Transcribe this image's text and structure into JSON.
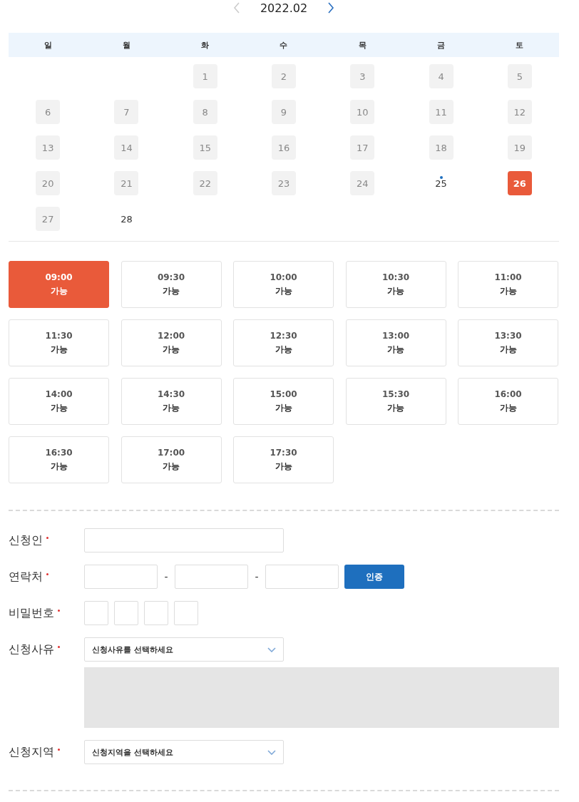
{
  "calendar": {
    "month": "2022.02",
    "prev_disabled": true,
    "next_disabled": false,
    "weekdays": [
      "일",
      "월",
      "화",
      "수",
      "목",
      "금",
      "토"
    ],
    "days": [
      {
        "kind": "empty"
      },
      {
        "kind": "empty"
      },
      {
        "kind": "day",
        "day": "1",
        "available": true,
        "today": false,
        "selected": false
      },
      {
        "kind": "day",
        "day": "2",
        "available": true,
        "today": false,
        "selected": false
      },
      {
        "kind": "day",
        "day": "3",
        "available": true,
        "today": false,
        "selected": false
      },
      {
        "kind": "day",
        "day": "4",
        "available": true,
        "today": false,
        "selected": false
      },
      {
        "kind": "day",
        "day": "5",
        "available": true,
        "today": false,
        "selected": false
      },
      {
        "kind": "day",
        "day": "6",
        "available": true,
        "today": false,
        "selected": false
      },
      {
        "kind": "day",
        "day": "7",
        "available": true,
        "today": false,
        "selected": false
      },
      {
        "kind": "day",
        "day": "8",
        "available": true,
        "today": false,
        "selected": false
      },
      {
        "kind": "day",
        "day": "9",
        "available": true,
        "today": false,
        "selected": false
      },
      {
        "kind": "day",
        "day": "10",
        "available": true,
        "today": false,
        "selected": false
      },
      {
        "kind": "day",
        "day": "11",
        "available": true,
        "today": false,
        "selected": false
      },
      {
        "kind": "day",
        "day": "12",
        "available": true,
        "today": false,
        "selected": false
      },
      {
        "kind": "day",
        "day": "13",
        "available": true,
        "today": false,
        "selected": false
      },
      {
        "kind": "day",
        "day": "14",
        "available": true,
        "today": false,
        "selected": false
      },
      {
        "kind": "day",
        "day": "15",
        "available": true,
        "today": false,
        "selected": false
      },
      {
        "kind": "day",
        "day": "16",
        "available": true,
        "today": false,
        "selected": false
      },
      {
        "kind": "day",
        "day": "17",
        "available": true,
        "today": false,
        "selected": false
      },
      {
        "kind": "day",
        "day": "18",
        "available": true,
        "today": false,
        "selected": false
      },
      {
        "kind": "day",
        "day": "19",
        "available": true,
        "today": false,
        "selected": false
      },
      {
        "kind": "day",
        "day": "20",
        "available": true,
        "today": false,
        "selected": false
      },
      {
        "kind": "day",
        "day": "21",
        "available": true,
        "today": false,
        "selected": false
      },
      {
        "kind": "day",
        "day": "22",
        "available": true,
        "today": false,
        "selected": false
      },
      {
        "kind": "day",
        "day": "23",
        "available": true,
        "today": false,
        "selected": false
      },
      {
        "kind": "day",
        "day": "24",
        "available": true,
        "today": false,
        "selected": false
      },
      {
        "kind": "day",
        "day": "25",
        "available": false,
        "today": true,
        "selected": false
      },
      {
        "kind": "day",
        "day": "26",
        "available": true,
        "today": false,
        "selected": true
      },
      {
        "kind": "day",
        "day": "27",
        "available": true,
        "today": false,
        "selected": false
      },
      {
        "kind": "day",
        "day": "28",
        "available": false,
        "today": false,
        "selected": false
      }
    ]
  },
  "time_slots": [
    {
      "time": "09:00",
      "status": "가능",
      "selected": true
    },
    {
      "time": "09:30",
      "status": "가능",
      "selected": false
    },
    {
      "time": "10:00",
      "status": "가능",
      "selected": false
    },
    {
      "time": "10:30",
      "status": "가능",
      "selected": false
    },
    {
      "time": "11:00",
      "status": "가능",
      "selected": false
    },
    {
      "time": "11:30",
      "status": "가능",
      "selected": false
    },
    {
      "time": "12:00",
      "status": "가능",
      "selected": false
    },
    {
      "time": "12:30",
      "status": "가능",
      "selected": false
    },
    {
      "time": "13:00",
      "status": "가능",
      "selected": false
    },
    {
      "time": "13:30",
      "status": "가능",
      "selected": false
    },
    {
      "time": "14:00",
      "status": "가능",
      "selected": false
    },
    {
      "time": "14:30",
      "status": "가능",
      "selected": false
    },
    {
      "time": "15:00",
      "status": "가능",
      "selected": false
    },
    {
      "time": "15:30",
      "status": "가능",
      "selected": false
    },
    {
      "time": "16:00",
      "status": "가능",
      "selected": false
    },
    {
      "time": "16:30",
      "status": "가능",
      "selected": false
    },
    {
      "time": "17:00",
      "status": "가능",
      "selected": false
    },
    {
      "time": "17:30",
      "status": "가능",
      "selected": false
    }
  ],
  "form": {
    "fields": [
      {
        "kind": "text",
        "label": "신청인",
        "required": true
      },
      {
        "kind": "phone",
        "label": "연락처",
        "required": true,
        "separators": [
          "-",
          "-"
        ],
        "button": "인증"
      },
      {
        "kind": "pin",
        "label": "비밀번호",
        "required": true,
        "boxes": [
          {
            "kind": "digit"
          },
          {
            "kind": "digit"
          },
          {
            "kind": "digit"
          },
          {
            "kind": "digit"
          }
        ]
      },
      {
        "kind": "select",
        "label": "신청사유",
        "required": true,
        "placeholder": "신청사유를 선택하세요",
        "detail": {
          "disabled": true
        }
      },
      {
        "kind": "select",
        "label": "신청지역",
        "required": true,
        "placeholder": "신청지역을 선택하세요"
      }
    ]
  }
}
